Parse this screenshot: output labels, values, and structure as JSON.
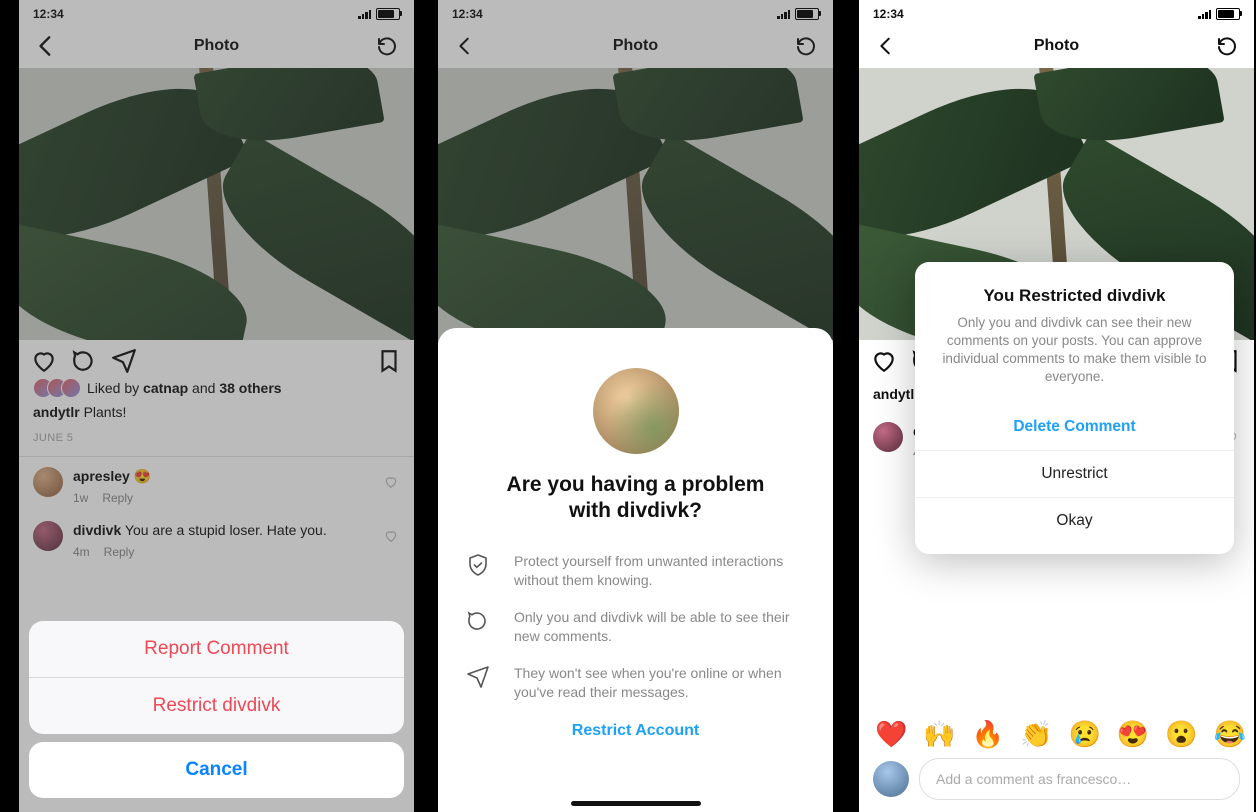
{
  "status": {
    "time": "12:34"
  },
  "header": {
    "title": "Photo"
  },
  "post": {
    "liked_prefix": "Liked by ",
    "liked_user": "catnap",
    "liked_and": " and ",
    "liked_others": "38 others",
    "author": "andytlr",
    "caption": " Plants!",
    "date": "JUNE 5"
  },
  "comments": [
    {
      "user": "apresley",
      "text": " 😍",
      "age": "1w",
      "reply": "Reply"
    },
    {
      "user": "divdivk",
      "text": " You are a stupid loser. Hate you.",
      "age": "4m",
      "reply": "Reply"
    }
  ],
  "actionsheet": {
    "report": "Report Comment",
    "restrict": "Restrict divdivk",
    "cancel": "Cancel"
  },
  "restrict_dialog": {
    "title": "Are you having a problem with divdivk?",
    "feat1": "Protect yourself from unwanted interactions without them knowing.",
    "feat2": "Only you and divdivk will be able to see their new comments.",
    "feat3": "They won't see when you're online or when you've read their messages.",
    "cta": "Restrict Account"
  },
  "confirm_alert": {
    "title": "You Restricted divdivk",
    "body": "Only you and divdivk can see their new comments on your posts. You can approve individual comments to make them visible to everyone.",
    "delete": "Delete Comment",
    "unrestrict": "Unrestrict",
    "okay": "Okay"
  },
  "composer": {
    "placeholder": "Add a comment as francesco…",
    "reactions": [
      "❤️",
      "🙌",
      "🔥",
      "👏",
      "😢",
      "😍",
      "😮",
      "😂"
    ]
  }
}
